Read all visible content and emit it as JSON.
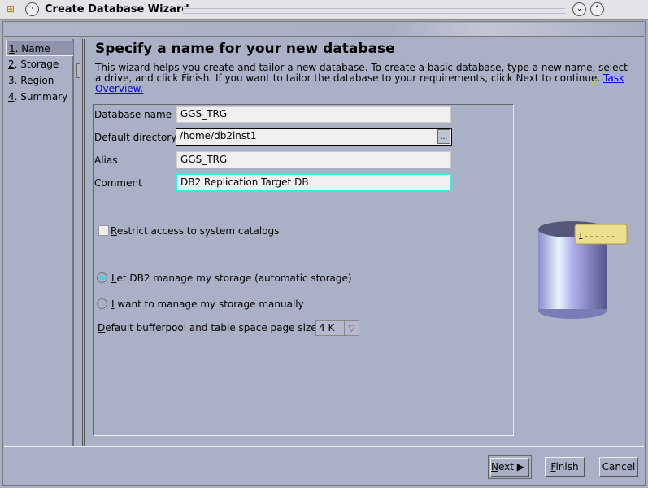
{
  "window": {
    "title": "Create Database Wizard"
  },
  "steps": [
    {
      "num": "1",
      "label": ". Name"
    },
    {
      "num": "2",
      "label": ". Storage"
    },
    {
      "num": "3",
      "label": ". Region"
    },
    {
      "num": "4",
      "label": ". Summary"
    }
  ],
  "page": {
    "heading": "Specify a name for your new database",
    "intro": "This wizard helps you create and tailor a new database. To create a basic database, type a new name, select a drive, and click Finish. If you want to tailor the database to your requirements, click Next to continue. ",
    "intro_link": "Task Overview."
  },
  "form": {
    "db_name_label": "Database name",
    "db_name": "GGS_TRG",
    "dir_label": "Default directory",
    "dir": "/home/db2inst1",
    "browse": "...",
    "alias_label": "Alias",
    "alias": "GGS_TRG",
    "comment_label": "Comment",
    "comment": "DB2 Replication Target DB",
    "restrict_mn": "R",
    "restrict_rest": "estrict access to system catalogs",
    "restrict_checked": false,
    "auto_mn": "L",
    "auto_rest": "et DB2 manage my storage (automatic storage)",
    "auto_selected": true,
    "manual_mn": "I",
    "manual_rest": " want to manage my storage manually",
    "manual_selected": false,
    "pagesize_mn": "D",
    "pagesize_rest": "efault bufferpool and table space page size",
    "pagesize": "4 K"
  },
  "buttons": {
    "next_mn": "N",
    "next_rest": "ext",
    "finish_mn": "F",
    "finish_rest": "inish",
    "cancel": "Cancel"
  }
}
